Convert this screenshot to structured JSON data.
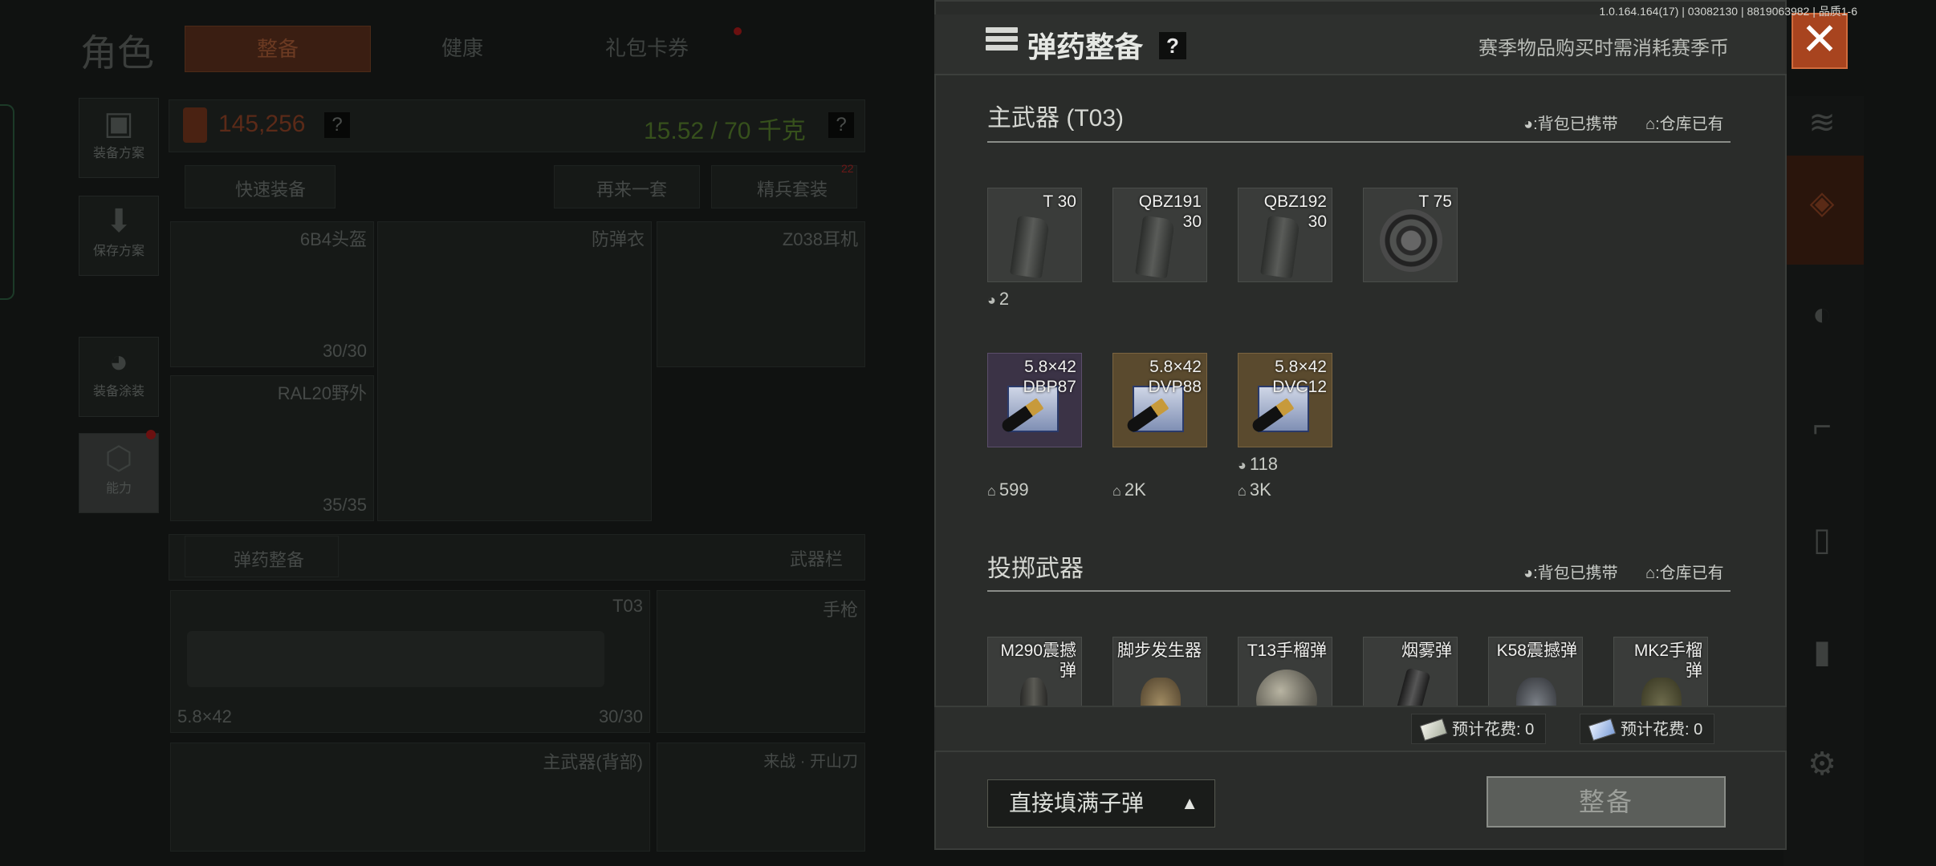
{
  "version": "1.0.164.164(17) | 03082130 | 8819063982 | 品质1-6",
  "background": {
    "page_title": "角色",
    "tabs": [
      {
        "label": "整备",
        "active": true
      },
      {
        "label": "健康",
        "active": false
      },
      {
        "label": "礼包卡券",
        "active": false
      }
    ],
    "left_buttons": [
      {
        "label": "装备方案",
        "icon": "vest-icon"
      },
      {
        "label": "保存方案",
        "icon": "download-icon"
      },
      {
        "label": "装备涂装",
        "icon": "helmet-paint-icon"
      },
      {
        "label": "能力",
        "icon": "ability-icon"
      }
    ],
    "money": "145,256",
    "weight": "15.52 / 70 千克",
    "quick_equip": "快速装备",
    "again": "再来一套",
    "elite_set": "精兵套装",
    "elite_badge": "22",
    "slots": {
      "helmet": {
        "name": "6B4头盔",
        "durability": "30/30"
      },
      "armor": {
        "name": "防弹衣"
      },
      "headset": {
        "name": "Z038耳机"
      },
      "mask": {
        "name": "RAL20野外",
        "durability": "35/35"
      }
    },
    "ammo_button": "弹药整备",
    "weapon_bar": "武器栏",
    "primary_weapon": {
      "name": "T03",
      "caliber": "5.8×42",
      "ammo": "30/30"
    },
    "pistol": "手枪",
    "back_weapon": "主武器(背部)",
    "melee": "来战 · 开山刀"
  },
  "modal": {
    "title": "弹药整备",
    "help": "?",
    "note": "赛季物品购买时需消耗赛季币",
    "close_icon": "close-icon",
    "legend_bag": "背包已携带",
    "legend_warehouse": "仓库已有",
    "primary_section": {
      "title": "主武器 (T03)",
      "magazines": [
        {
          "label": "T 30",
          "bag_count": "2",
          "warehouse_count": null
        },
        {
          "label": "QBZ191\n30",
          "bag_count": null,
          "warehouse_count": null
        },
        {
          "label": "QBZ192\n30",
          "bag_count": null,
          "warehouse_count": null
        },
        {
          "label": "T 75",
          "bag_count": null,
          "warehouse_count": null
        }
      ],
      "ammo": [
        {
          "label": "5.8×42\nDBP87",
          "quality": "purple",
          "bag_count": null,
          "warehouse_count": "599"
        },
        {
          "label": "5.8×42\nDVP88",
          "quality": "gold",
          "bag_count": null,
          "warehouse_count": "2K"
        },
        {
          "label": "5.8×42\nDVC12",
          "quality": "gold",
          "bag_count": "118",
          "warehouse_count": "3K"
        }
      ]
    },
    "throwables_section": {
      "title": "投掷武器",
      "items": [
        {
          "label": "M290震撼\n弹"
        },
        {
          "label": "脚步发生器"
        },
        {
          "label": "T13手榴弹"
        },
        {
          "label": "烟雾弹"
        },
        {
          "label": "K58震撼弹"
        },
        {
          "label": "MK2手榴\n弹"
        }
      ]
    },
    "cost_1": "预计花费: 0",
    "cost_2": "预计花费: 0",
    "fill_option": "直接填满子弹",
    "confirm": "整备"
  }
}
